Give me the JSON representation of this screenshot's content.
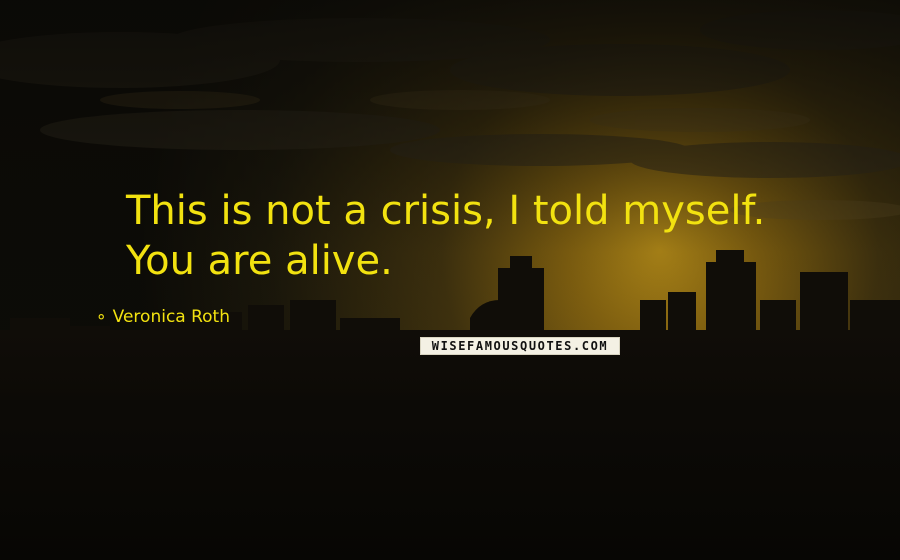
{
  "quote": {
    "line1": "This is not a crisis, I told myself.",
    "line2": "You are alive."
  },
  "author": {
    "dash": "∘",
    "name": "Veronica Roth"
  },
  "watermark": {
    "text": "WISEFAMOUSQUOTES.COM"
  },
  "colors": {
    "quote_text": "#f2e210",
    "sky_dark": "#0b0a06",
    "sky_glow": "#c89a1a",
    "watermark_bg": "#f4f1e4"
  }
}
